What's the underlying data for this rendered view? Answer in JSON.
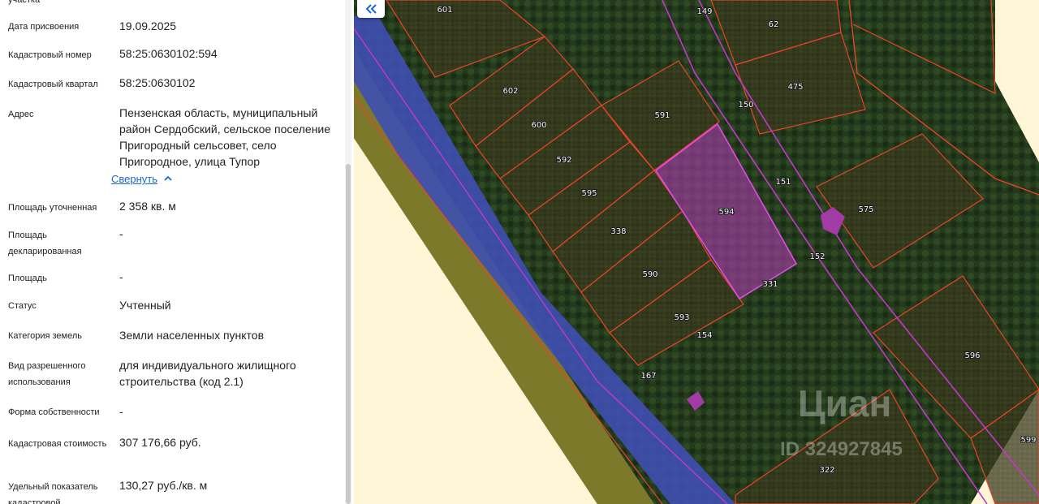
{
  "panel": {
    "top_label_fragment": "участка",
    "rows": [
      {
        "label": "Дата присвоения",
        "value": "19.09.2025"
      },
      {
        "label": "Кадастровый номер",
        "value": "58:25:0630102:594"
      },
      {
        "label": "Кадастровый квартал",
        "value": "58:25:0630102"
      },
      {
        "label": "Адрес",
        "value": "Пензенская область, муниципальный район Сердобский, сельское поселение Пригородный сельсовет, село Пригородное, улица Тупор"
      },
      {
        "label": "Площадь уточненная",
        "value": "2 358 кв. м"
      },
      {
        "label": "Площадь декларированная",
        "value": "-"
      },
      {
        "label": "Площадь",
        "value": "-"
      },
      {
        "label": "Статус",
        "value": "Учтенный"
      },
      {
        "label": "Категория земель",
        "value": "Земли населенных пунктов"
      },
      {
        "label": "Вид разрешенного использования",
        "value": "для индивидуального жилищного строительства (код 2.1)"
      },
      {
        "label": "Форма собственности",
        "value": "-"
      },
      {
        "label": "Кадастровая стоимость",
        "value": "307 176,66 руб."
      },
      {
        "label": "Удельный показатель кадастровой",
        "value": "130,27 руб./кв. м"
      }
    ],
    "collapse_link": "Свернуть"
  },
  "map": {
    "collapse_icon": "double-chevron-left-icon",
    "selected_parcel": "594",
    "parcel_labels": [
      "601",
      "149",
      "62",
      "602",
      "475",
      "150",
      "600",
      "591",
      "592",
      "151",
      "595",
      "594",
      "575",
      "338",
      "152",
      "590",
      "331",
      "593",
      "154",
      "596",
      "167",
      "599",
      "322"
    ],
    "watermark_brand": "Циан",
    "watermark_id": "ID 324927845",
    "colors": {
      "parcel_outline": "#e8442a",
      "selected_fill": "#a23ba3",
      "water_zone": "#3f4fb3",
      "accent": "#1a66d6"
    }
  }
}
